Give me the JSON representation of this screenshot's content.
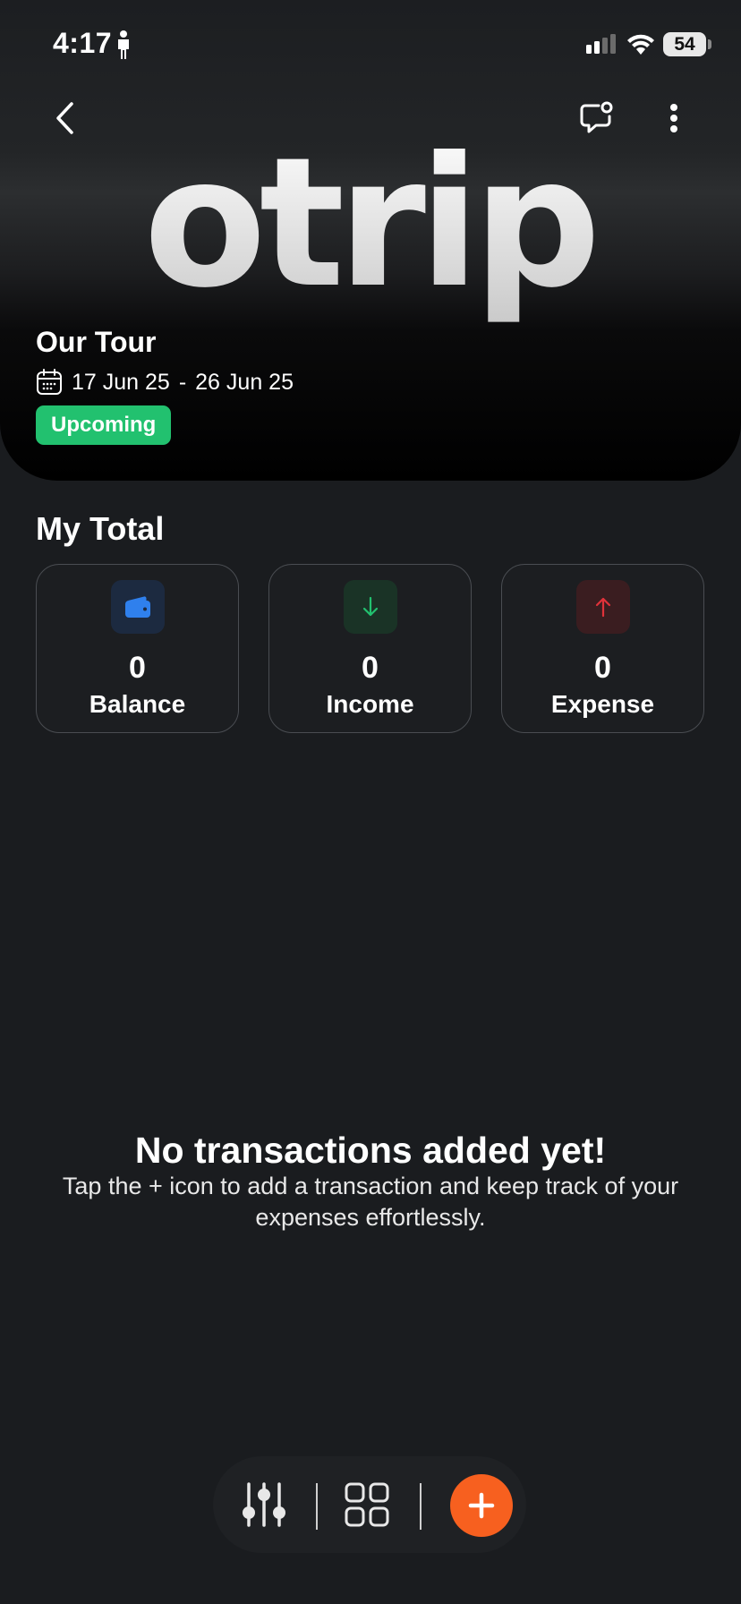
{
  "status_bar": {
    "time": "4:17",
    "battery": "54"
  },
  "header": {
    "logo_text": "otrip",
    "trip_title": "Our Tour",
    "date_start": "17 Jun 25",
    "date_separator": "-",
    "date_end": "26 Jun 25",
    "status_badge": "Upcoming",
    "badge_color": "#22c16f"
  },
  "totals": {
    "title": "My Total",
    "cards": [
      {
        "label": "Balance",
        "value": "0",
        "icon": "wallet-icon",
        "accent": "#2f80ed"
      },
      {
        "label": "Income",
        "value": "0",
        "icon": "arrow-down-icon",
        "accent": "#22c16f"
      },
      {
        "label": "Expense",
        "value": "0",
        "icon": "arrow-up-icon",
        "accent": "#e0323a"
      }
    ]
  },
  "empty_state": {
    "title": "No transactions added yet!",
    "description": "Tap the + icon to add a transaction and keep track of your expenses effortlessly."
  },
  "bottom_bar": {
    "icons": [
      "sliders-icon",
      "grid-icon",
      "plus-icon"
    ],
    "add_color": "#f7601f"
  }
}
